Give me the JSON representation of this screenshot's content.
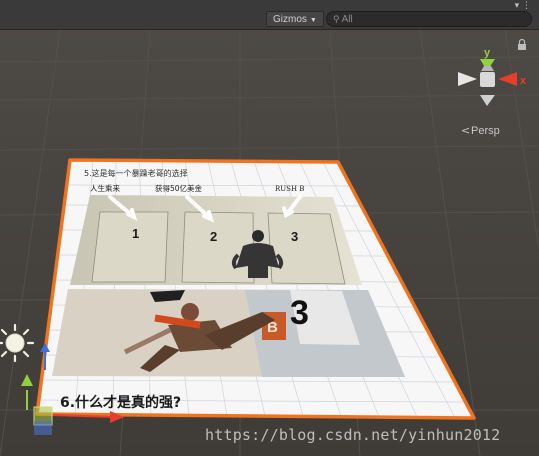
{
  "toolbar": {
    "gizmos_label": "Gizmos",
    "search_placeholder": "All",
    "menu_icon": "kebab-icon"
  },
  "orientation_gizmo": {
    "y_label": "y",
    "x_label": "x",
    "projection_label": "Persp"
  },
  "worksheet": {
    "question5": "5.这是每一个暴躁老哥的选择",
    "door_captions": [
      "人生乘来",
      "获得50亿美金",
      "RUSH B"
    ],
    "door_numbers": [
      "1",
      "2",
      "3"
    ],
    "big_number": "3",
    "sign_letter": "B",
    "question6": "6.什么才是真的强?"
  },
  "colors": {
    "selection_outline": "#f07420",
    "axis_x": "#e63d2c",
    "axis_y": "#8fd13f",
    "axis_z": "#3e6fd9",
    "background": "#474440"
  },
  "watermark": "https://blog.csdn.net/yinhun2012"
}
